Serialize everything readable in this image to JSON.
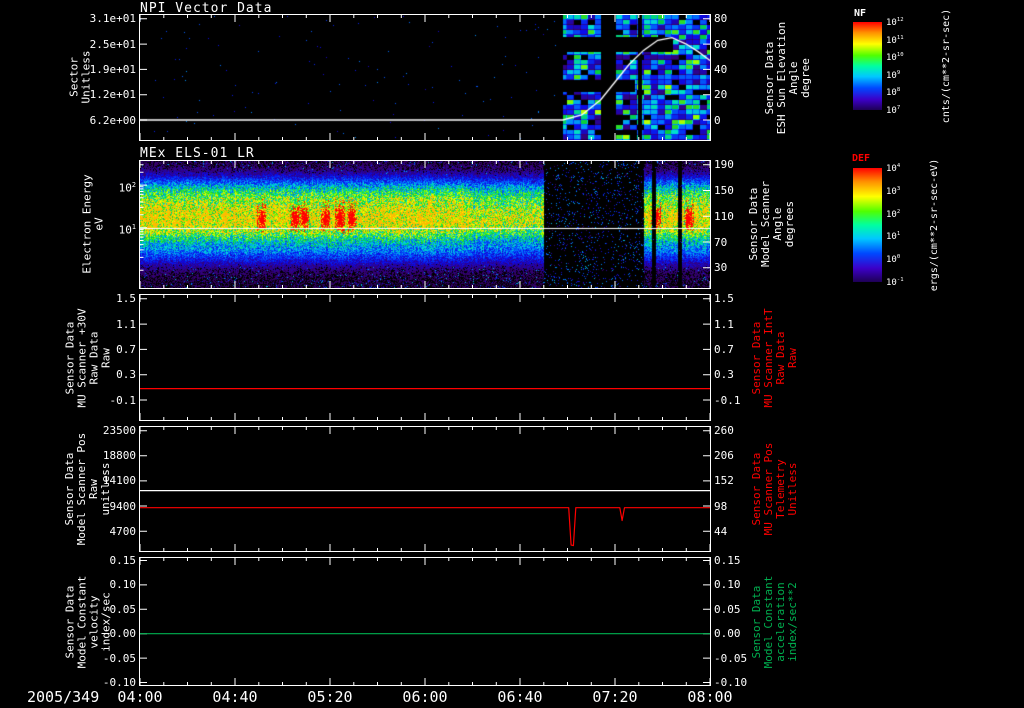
{
  "x_axis": {
    "date_label": "2005/349",
    "start_minutes": 0,
    "end_minutes": 240,
    "tick_labels": [
      "04:00",
      "04:40",
      "05:20",
      "06:00",
      "06:40",
      "07:20",
      "08:00"
    ],
    "tick_minutes": [
      0,
      40,
      80,
      120,
      160,
      200,
      240
    ],
    "minor_tick_step_minutes": 10
  },
  "panels": [
    {
      "title": "NPI Vector Data",
      "left_label": "Sector\nUnitless",
      "right_label": "Sensor Data\nESH Sun Elevation\nAngle\ndegree",
      "left_label_color": "#ffffff",
      "right_label_color": "#ffffff",
      "yticks_left": [
        {
          "label": "3.1e+01",
          "frac": 0.03
        },
        {
          "label": "2.5e+01",
          "frac": 0.2325
        },
        {
          "label": "1.9e+01",
          "frac": 0.435
        },
        {
          "label": "1.2e+01",
          "frac": 0.6375
        },
        {
          "label": "6.2e+00",
          "frac": 0.84
        }
      ],
      "yticks_right": [
        {
          "label": "80",
          "frac": 0.03
        },
        {
          "label": "60",
          "frac": 0.2325
        },
        {
          "label": "40",
          "frac": 0.435
        },
        {
          "label": "20",
          "frac": 0.6375
        },
        {
          "label": "0",
          "frac": 0.84
        }
      ]
    },
    {
      "title": "MEx ELS-01 LR",
      "left_label": "Electron Energy\neV",
      "right_label": "Sensor Data\nModel Scanner\nAngle\ndegrees",
      "left_label_color": "#ffffff",
      "right_label_color": "#ffffff",
      "yticks_left": [
        {
          "label": "10^2",
          "frac": 0.19
        },
        {
          "label": "10^1",
          "frac": 0.525
        }
      ],
      "yticks_left_minor_fracs": [
        0.03,
        0.089,
        0.202,
        0.22,
        0.24,
        0.263,
        0.29,
        0.323,
        0.365,
        0.424,
        0.54,
        0.557,
        0.577,
        0.599,
        0.626,
        0.658,
        0.7,
        0.759,
        0.86
      ],
      "yticks_right": [
        {
          "label": "190",
          "frac": 0.03
        },
        {
          "label": "150",
          "frac": 0.2325
        },
        {
          "label": "110",
          "frac": 0.435
        },
        {
          "label": "70",
          "frac": 0.6375
        },
        {
          "label": "30",
          "frac": 0.84
        }
      ]
    },
    {
      "title": "",
      "left_label": "Sensor Data\nMU Scanner +30V\nRaw Data\nRaw",
      "right_label": "Sensor Data\nMU Scanner IntT\nRaw Data\nRaw",
      "left_label_color": "#ffffff",
      "right_label_color": "#ff0000",
      "yticks_left": [
        {
          "label": "1.5",
          "frac": 0.03
        },
        {
          "label": "1.1",
          "frac": 0.2325
        },
        {
          "label": "0.7",
          "frac": 0.435
        },
        {
          "label": "0.3",
          "frac": 0.6375
        },
        {
          "label": "-0.1",
          "frac": 0.84
        }
      ],
      "yticks_right": [
        {
          "label": "1.5",
          "frac": 0.03
        },
        {
          "label": "1.1",
          "frac": 0.2325
        },
        {
          "label": "0.7",
          "frac": 0.435
        },
        {
          "label": "0.3",
          "frac": 0.6375
        },
        {
          "label": "-0.1",
          "frac": 0.84
        }
      ]
    },
    {
      "title": "",
      "left_label": "Sensor Data\nModel Scanner Pos\nRaw\nunitless",
      "right_label": "Sensor Data\nMU Scanner Pos\nTelemetry\nUnitless",
      "left_label_color": "#ffffff",
      "right_label_color": "#ff0000",
      "yticks_left": [
        {
          "label": "23500",
          "frac": 0.03
        },
        {
          "label": "18800",
          "frac": 0.2325
        },
        {
          "label": "14100",
          "frac": 0.435
        },
        {
          "label": "9400",
          "frac": 0.6375
        },
        {
          "label": "4700",
          "frac": 0.84
        }
      ],
      "yticks_right": [
        {
          "label": "260",
          "frac": 0.03
        },
        {
          "label": "206",
          "frac": 0.2325
        },
        {
          "label": "152",
          "frac": 0.435
        },
        {
          "label": "98",
          "frac": 0.6375
        },
        {
          "label": "44",
          "frac": 0.84
        }
      ]
    },
    {
      "title": "",
      "left_label": "Sensor Data\nModel Constant\nvelocity\nindex/sec",
      "right_label": "Sensor Data\nModel Constant\nacceleration\nindex/sec**2",
      "left_label_color": "#ffffff",
      "right_label_color": "#00b050",
      "yticks_left": [
        {
          "label": "0.15",
          "frac": 0.02
        },
        {
          "label": "0.10",
          "frac": 0.212
        },
        {
          "label": "0.05",
          "frac": 0.404
        },
        {
          "label": "0.00",
          "frac": 0.596
        },
        {
          "label": "-0.05",
          "frac": 0.788
        },
        {
          "label": "-0.10",
          "frac": 0.98
        }
      ],
      "yticks_right": [
        {
          "label": "0.15",
          "frac": 0.02
        },
        {
          "label": "0.10",
          "frac": 0.212
        },
        {
          "label": "0.05",
          "frac": 0.404
        },
        {
          "label": "0.00",
          "frac": 0.596
        },
        {
          "label": "-0.05",
          "frac": 0.788
        },
        {
          "label": "-0.10",
          "frac": 0.98
        }
      ]
    }
  ],
  "colorbars": [
    {
      "name": "NF",
      "name_color": "#ffffff",
      "unit": "cnts/(cm**2-sr-sec)",
      "ticks": [
        "10^12",
        "10^11",
        "10^10",
        "10^9",
        "10^8",
        "10^7"
      ]
    },
    {
      "name": "DEF",
      "name_color": "#ff0000",
      "unit": "ergs/(cm**2-sr-sec-eV)",
      "ticks": [
        "10^4",
        "10^3",
        "10^2",
        "10^1",
        "10^0",
        "10^-1"
      ]
    }
  ],
  "chart_data": [
    {
      "type": "heatmap",
      "title": "NPI Vector Data",
      "xlabel": "Time, 2005/349 04:00-08:00",
      "ylabel": "Sector (Unitless)",
      "y2label": "Sensor Data ESH Sun Elevation Angle (degree)",
      "left_tick_values": [
        31,
        25,
        19,
        12,
        6.2
      ],
      "right_tick_values": [
        80,
        60,
        40,
        20,
        0
      ],
      "colorbar_name": "NF",
      "colorbar_unit": "cnts/(cm**2-sr-sec)",
      "active_minutes": [
        178,
        240
      ],
      "black_bands": {
        "h1_frac": [
          0.17,
          0.29
        ],
        "h1_minutes": [
          178,
          224
        ],
        "h2_frac": [
          0.52,
          0.61
        ],
        "h2_minutes": [
          178,
          208
        ],
        "v1_minutes": [
          194,
          200
        ],
        "v2_minutes": [
          209.5,
          211
        ]
      },
      "ymap": {
        "v_top": 80,
        "f_top": 0.03,
        "v_bot": 0,
        "f_bot": 0.84
      },
      "sun_elevation_points": [
        [
          0,
          0
        ],
        [
          178,
          0
        ],
        [
          186,
          4
        ],
        [
          194,
          16
        ],
        [
          200,
          30
        ],
        [
          206,
          44
        ],
        [
          212,
          55
        ],
        [
          218,
          63
        ],
        [
          224,
          65
        ],
        [
          230,
          60
        ],
        [
          235,
          54
        ],
        [
          240,
          47
        ]
      ]
    },
    {
      "type": "heatmap",
      "title": "MEx ELS-01 LR",
      "xlabel": "Time, 2005/349 04:00-08:00",
      "ylabel": "Electron Energy (eV), log scale 10^1-10^2",
      "y2label": "Sensor Data Model Scanner Angle (degrees)",
      "right_tick_values": [
        190,
        150,
        110,
        70,
        30
      ],
      "colorbar_name": "DEF",
      "colorbar_unit": "ergs/(cm**2-sr-sec-eV)",
      "energy_band_eV": [
        6,
        40
      ],
      "band_center_frac": 0.47,
      "band_sigma": 0.105,
      "upper_wash_frac": 0.27,
      "lower_wash_frac": 0.7,
      "segments": [
        {
          "minutes": [
            0,
            170
          ],
          "state": "active"
        },
        {
          "minutes": [
            170,
            212
          ],
          "state": "sparse"
        },
        {
          "minutes": [
            212,
            240
          ],
          "state": "active"
        }
      ],
      "data_gaps_minutes": [
        [
          215.5,
          217
        ],
        [
          226.5,
          228
        ]
      ],
      "red_blob_minutes": [
        51,
        65,
        69,
        78,
        84,
        89,
        217,
        231
      ],
      "scanner_line_frac": 0.53
    },
    {
      "type": "line",
      "ylabel": "Sensor Data MU Scanner +30V Raw Data (Raw)",
      "y2label": "Sensor Data MU Scanner IntT Raw Data (Raw)",
      "ytick_values": [
        1.5,
        1.1,
        0.7,
        0.3,
        -0.1
      ],
      "ymap": {
        "v_top": 1.5,
        "f_top": 0.03,
        "v_bot": -0.1,
        "f_bot": 0.84
      },
      "series": [
        {
          "name": "MU Scanner IntT Raw",
          "color": "#ff0000",
          "points": [
            [
              0,
              0.08
            ],
            [
              240,
              0.08
            ]
          ]
        }
      ]
    },
    {
      "type": "line",
      "ylabel": "Sensor Data Model Scanner Pos Raw (unitless)",
      "y2label": "Sensor Data MU Scanner Pos Telemetry (Unitless)",
      "ytick_values_left": [
        23500,
        18800,
        14100,
        9400,
        4700
      ],
      "ytick_values_right": [
        260,
        206,
        152,
        98,
        44
      ],
      "ymap": {
        "v_top": 23500,
        "f_top": 0.03,
        "v_bot": 4700,
        "f_bot": 0.84
      },
      "series": [
        {
          "name": "Model Scanner Pos",
          "color": "#ffffff",
          "points": [
            [
              0,
              12300
            ],
            [
              240,
              12300
            ]
          ]
        },
        {
          "name": "MU Scanner Pos",
          "color": "#ff0000",
          "points": [
            [
              0,
              9100
            ],
            [
              180.5,
              9100
            ],
            [
              181.5,
              2100
            ],
            [
              182.5,
              2000
            ],
            [
              183.5,
              9100
            ],
            [
              202,
              9100
            ],
            [
              203,
              6700
            ],
            [
              204,
              9100
            ],
            [
              240,
              9100
            ]
          ]
        }
      ]
    },
    {
      "type": "line",
      "ylabel": "Sensor Data Model Constant velocity (index/sec)",
      "y2label": "Sensor Data Model Constant acceleration (index/sec**2)",
      "ytick_values": [
        0.15,
        0.1,
        0.05,
        0.0,
        -0.05,
        -0.1
      ],
      "ymap": {
        "v_top": 0.15,
        "f_top": 0.02,
        "v_bot": -0.1,
        "f_bot": 0.98
      },
      "series": [
        {
          "name": "Model Constant acceleration",
          "color": "#00b050",
          "points": [
            [
              0,
              0.0
            ],
            [
              240,
              0.0
            ]
          ]
        }
      ]
    }
  ]
}
